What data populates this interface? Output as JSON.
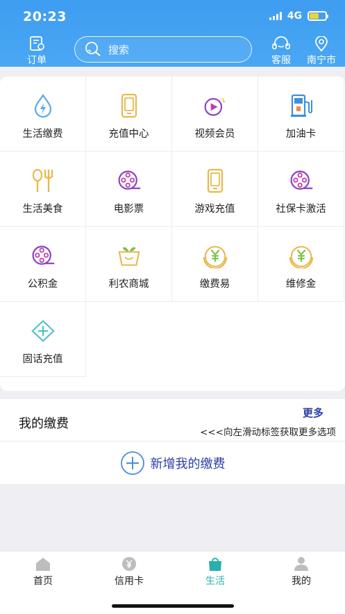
{
  "status_bar": {
    "time": "20:23",
    "network": "4G"
  },
  "header": {
    "orders_label": "订单",
    "search_placeholder": "搜索",
    "service_label": "客服",
    "city_label": "南宁市"
  },
  "services": [
    {
      "label": "生活缴费",
      "icon": "water-drop-bolt-icon"
    },
    {
      "label": "充值中心",
      "icon": "phone-icon"
    },
    {
      "label": "视频会员",
      "icon": "video-play-icon"
    },
    {
      "label": "加油卡",
      "icon": "fuel-pump-icon"
    },
    {
      "label": "生活美食",
      "icon": "fork-spoon-icon"
    },
    {
      "label": "电影票",
      "icon": "film-reel-icon"
    },
    {
      "label": "游戏充值",
      "icon": "phone-icon"
    },
    {
      "label": "社保卡激活",
      "icon": "film-reel-icon"
    },
    {
      "label": "公积金",
      "icon": "film-reel-icon"
    },
    {
      "label": "利农商城",
      "icon": "shopping-basket-icon"
    },
    {
      "label": "缴费易",
      "icon": "yuan-coin-icon"
    },
    {
      "label": "维修金",
      "icon": "yuan-coin-icon"
    },
    {
      "label": "固话充值",
      "icon": "plus-diamond-icon"
    }
  ],
  "my_payments": {
    "title": "我的缴费",
    "more": "更多",
    "hint": "<<<向左滑动标签获取更多选项",
    "add_label": "新增我的缴费"
  },
  "tabbar": {
    "items": [
      {
        "label": "首页",
        "icon": "home-icon"
      },
      {
        "label": "信用卡",
        "icon": "yuan-icon"
      },
      {
        "label": "生活",
        "icon": "bag-icon",
        "active": true
      },
      {
        "label": "我的",
        "icon": "user-icon"
      }
    ]
  },
  "colors": {
    "header": "#4aa7f4",
    "active_tab": "#27b0ad",
    "accent_text": "#2c3fa6"
  }
}
